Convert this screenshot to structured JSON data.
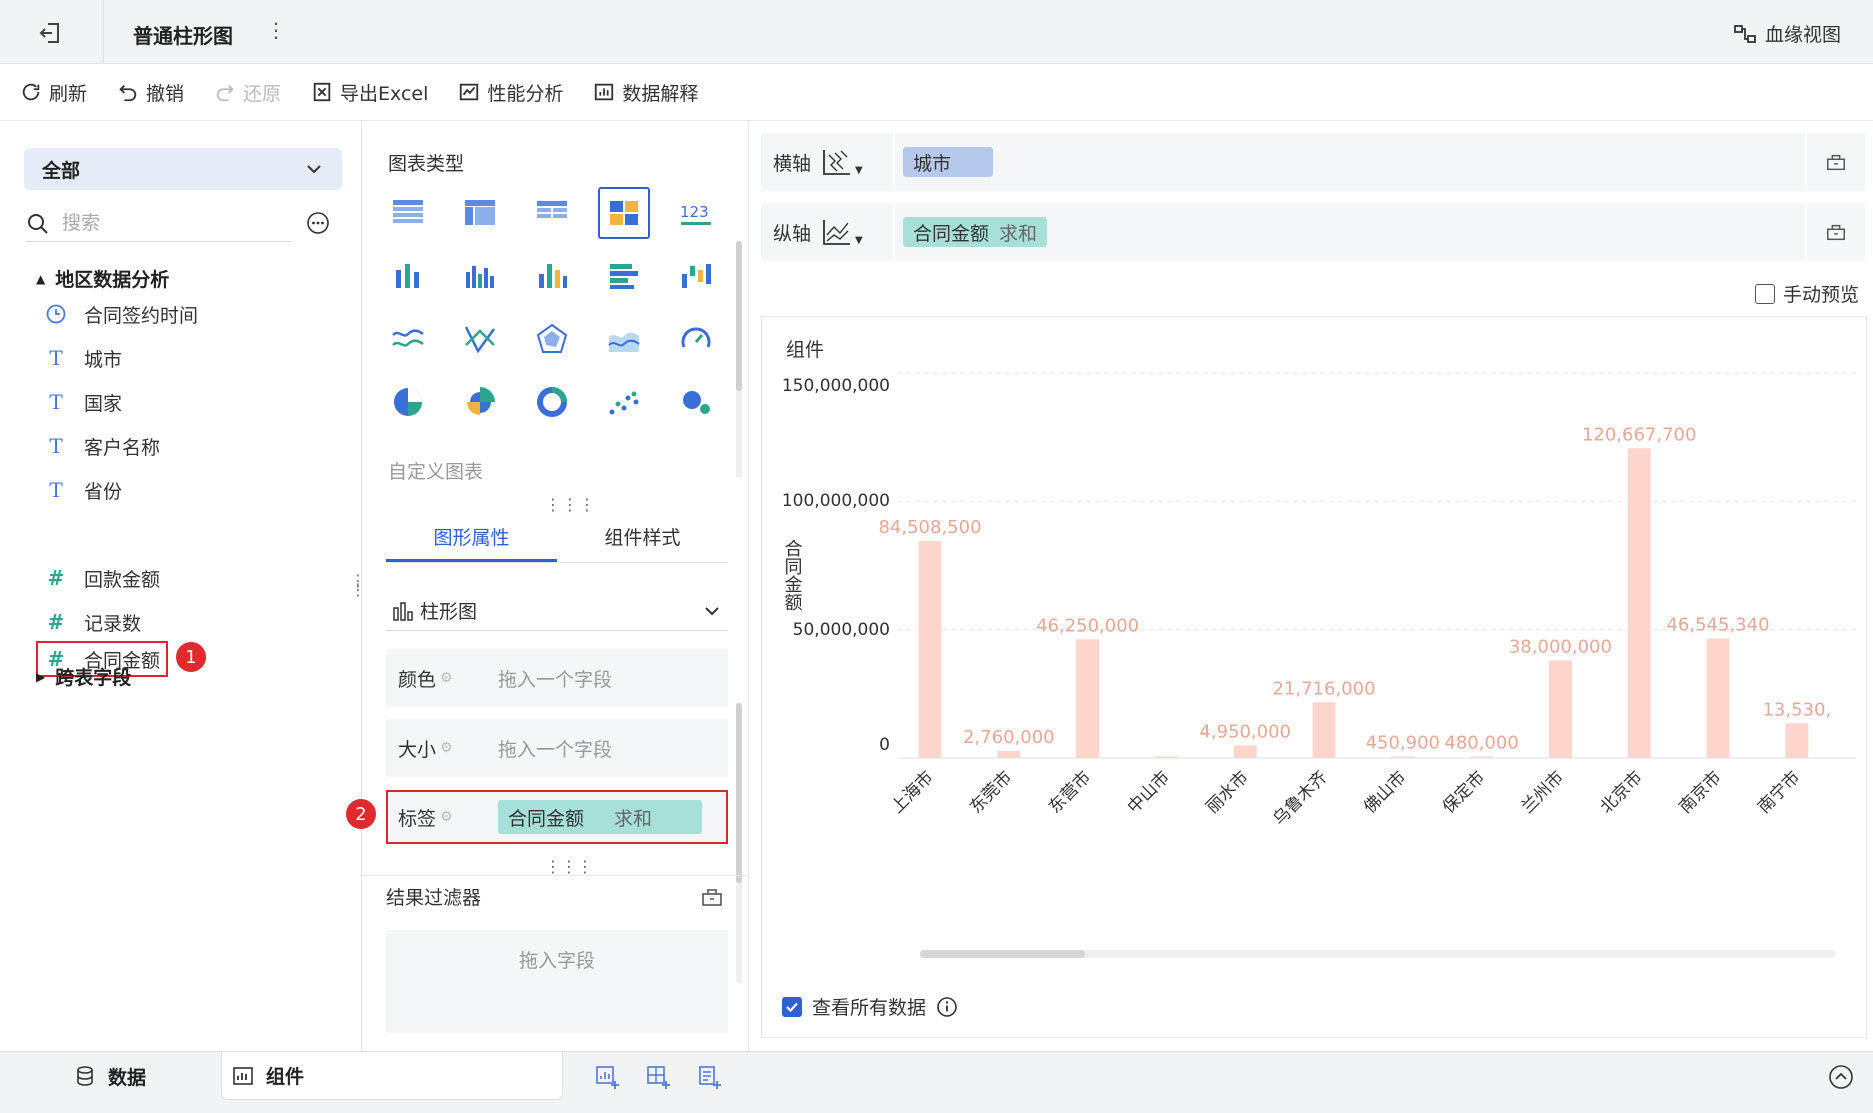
{
  "header": {
    "title": "普通柱形图",
    "lineage_label": "血缘视图"
  },
  "toolbar": {
    "refresh": "刷新",
    "undo": "撤销",
    "redo": "还原",
    "export": "导出Excel",
    "perf": "性能分析",
    "explain": "数据解释"
  },
  "left": {
    "category": "全部",
    "search_placeholder": "搜索",
    "group1": "地区数据分析",
    "fields": [
      {
        "label": "合同签约时间",
        "type": "time"
      },
      {
        "label": "城市",
        "type": "text"
      },
      {
        "label": "国家",
        "type": "text"
      },
      {
        "label": "客户名称",
        "type": "text"
      },
      {
        "label": "省份",
        "type": "text"
      },
      {
        "label": "合同金额",
        "type": "number"
      },
      {
        "label": "回款金额",
        "type": "number"
      },
      {
        "label": "记录数",
        "type": "number"
      }
    ],
    "group2": "跨表字段",
    "badge1": "1"
  },
  "mid": {
    "chart_type_title": "图表类型",
    "custom_chart": "自定义图表",
    "tabs": [
      "图形属性",
      "组件样式"
    ],
    "chart_select": "柱形图",
    "props": {
      "color": "颜色",
      "size": "大小",
      "label": "标签",
      "placeholder": "拖入一个字段"
    },
    "label_field": "合同金额",
    "label_agg": "求和",
    "badge2": "2",
    "filter_title": "结果过滤器",
    "filter_placeholder": "拖入字段"
  },
  "right": {
    "x_axis_label": "横轴",
    "x_field": "城市",
    "y_axis_label": "纵轴",
    "y_field": "合同金额",
    "y_agg": "求和",
    "manual_preview": "手动预览",
    "component_title": "组件",
    "view_all": "查看所有数据"
  },
  "chart_data": {
    "type": "bar",
    "ylabel": "合同金额",
    "ylim": [
      0,
      150000000
    ],
    "yticks": [
      "150,000,000",
      "100,000,000",
      "50,000,000",
      "0"
    ],
    "categories": [
      "上海市",
      "东莞市",
      "东营市",
      "中山市",
      "丽水市",
      "乌鲁木齐",
      "佛山市",
      "保定市",
      "兰州市",
      "北京市",
      "南京市",
      "南宁市"
    ],
    "values": [
      84508500,
      2760000,
      46250000,
      600000,
      4950000,
      21716000,
      450900,
      480000,
      38000000,
      120667700,
      46545340,
      13530000
    ],
    "labels": [
      "84,508,500",
      "2,760,000",
      "46,250,000",
      "",
      "4,950,000",
      "21,716,000",
      "450,900",
      "480,000",
      "38,000,000",
      "120,667,700",
      "46,545,340",
      "13,530,"
    ],
    "bar_color": "#fdd5cc",
    "label_color": "#e8a896"
  },
  "bottom": {
    "data_tab": "数据",
    "comp_tab": "组件"
  }
}
